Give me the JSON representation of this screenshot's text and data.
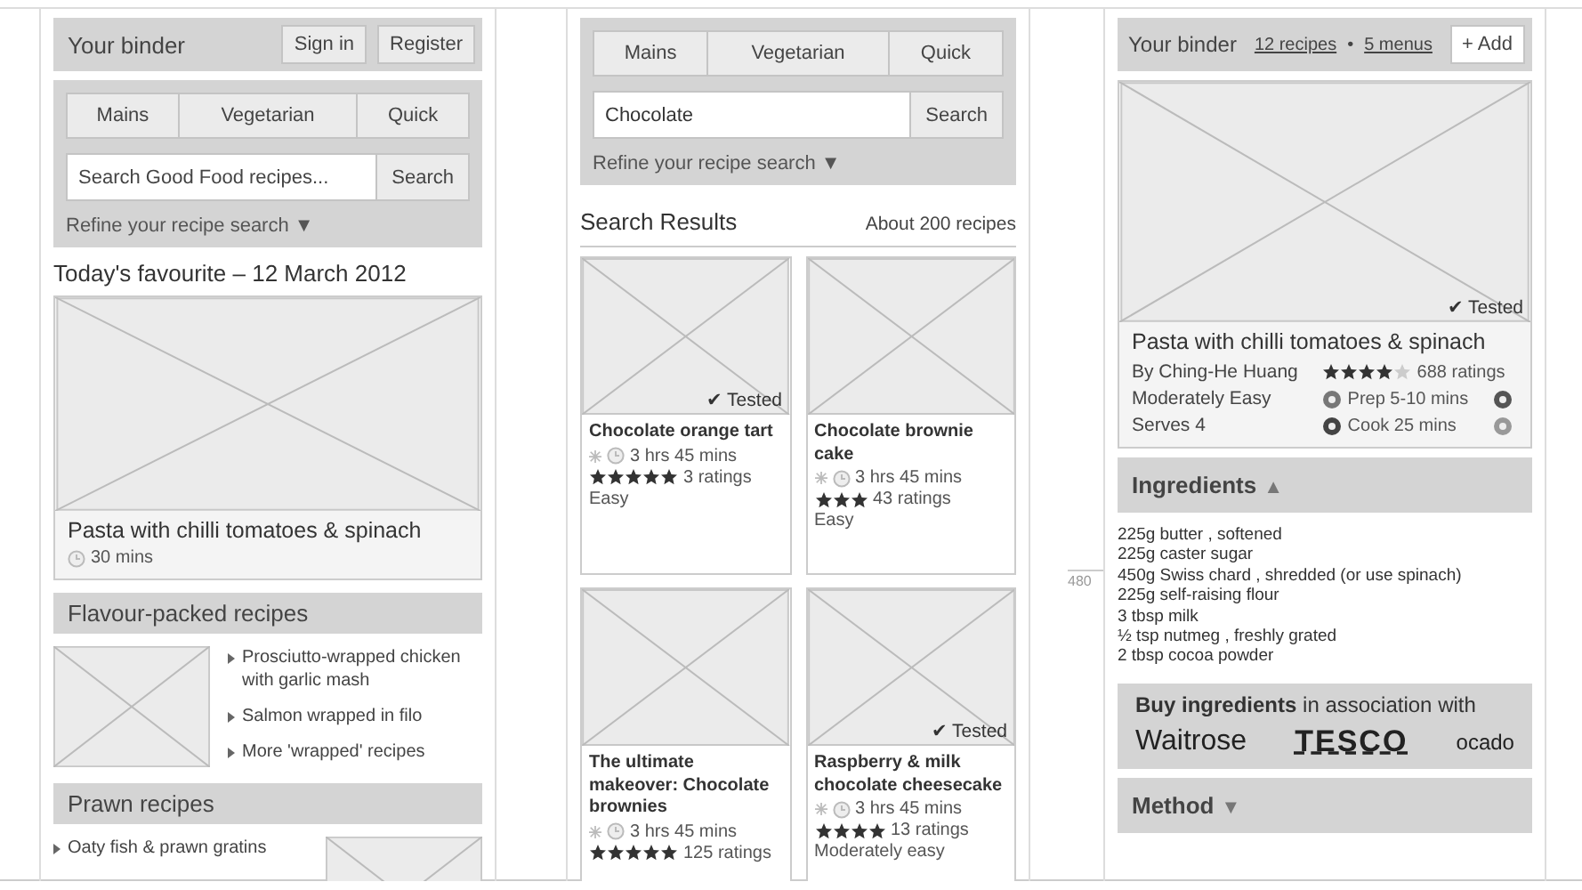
{
  "home": {
    "binder": {
      "title": "Your binder",
      "buttons": [
        "Sign in",
        "Register"
      ]
    },
    "search_panel": {
      "tabs": [
        {
          "label": "Mains"
        },
        {
          "label": "Vegetarian"
        },
        {
          "label": "Quick"
        }
      ],
      "placeholder": "Search Good Food recipes...",
      "button": "Search",
      "refine": {
        "label": "Refine your recipe search",
        "arrow": "▼"
      }
    },
    "favourite": {
      "heading": "Today's favourite – 12 March 2012",
      "title": "Pasta with chilli tomatoes & spinach",
      "time": "30 mins"
    },
    "sections": [
      {
        "title": "Flavour-packed recipes",
        "kind": "image_left",
        "links": [
          "Prosciutto-wrapped chicken with garlic mash",
          "Salmon wrapped in filo",
          "More 'wrapped' recipes"
        ]
      },
      {
        "title": "Prawn recipes",
        "kind": "image_right",
        "links": [
          "Oaty fish & prawn gratins"
        ]
      }
    ]
  },
  "search": {
    "search_panel": {
      "tabs": [
        {
          "label": "Mains"
        },
        {
          "label": "Vegetarian"
        },
        {
          "label": "Quick"
        }
      ],
      "value": "Chocolate",
      "button": "Search",
      "refine": {
        "label": "Refine your recipe search",
        "arrow": "▼"
      }
    },
    "results": {
      "heading": "Search Results",
      "count": "About 200 recipes"
    },
    "cards": [
      {
        "title": "Chocolate orange tart",
        "badge": "✔ Tested",
        "time": "3 hrs 45 mins",
        "stars": 5,
        "ratings": "3 ratings",
        "difficulty": "Easy"
      },
      {
        "title": "Chocolate brownie cake",
        "time": "3 hrs 45 mins",
        "stars": 3,
        "ratings": "43 ratings",
        "difficulty": "Easy"
      },
      {
        "title": "The ultimate makeover: Chocolate brownies",
        "time": "3 hrs 45 mins",
        "stars": 5,
        "ratings": "125 ratings"
      },
      {
        "title": "Raspberry & milk chocolate cheesecake",
        "badge": "✔ Tested",
        "time": "3 hrs 45 mins",
        "stars": 4,
        "ratings": "13 ratings",
        "difficulty": "Moderately easy"
      }
    ]
  },
  "recipe": {
    "binder": {
      "title": "Your binder",
      "links": [
        "12 recipes",
        "5 menus"
      ],
      "separator": "•",
      "button": "+ Add"
    },
    "hero": {
      "badge": "✔ Tested",
      "title": "Pasta with chilli tomatoes & spinach",
      "author": "By Ching-He Huang",
      "stars": 4,
      "ratings": "688 ratings",
      "difficulty": "Moderately Easy",
      "serves": "Serves 4",
      "prep": "Prep 5-10 mins",
      "cook": "Cook 25 mins"
    },
    "ingredients": {
      "label": "Ingredients",
      "arrow": "▲",
      "items": [
        "225g butter , softened",
        "225g caster sugar",
        "450g Swiss chard , shredded (or use spinach)",
        "225g self-raising flour",
        "3 tbsp milk",
        "½ tsp nutmeg , freshly grated",
        "2 tbsp cocoa powder"
      ]
    },
    "buy": {
      "text": "**Buy ingredients** in association with",
      "retailers": [
        "Waitrose",
        "TESCO",
        "ocado"
      ]
    },
    "method": {
      "label": "Method",
      "arrow": "▼"
    },
    "fold_marker": "480"
  }
}
